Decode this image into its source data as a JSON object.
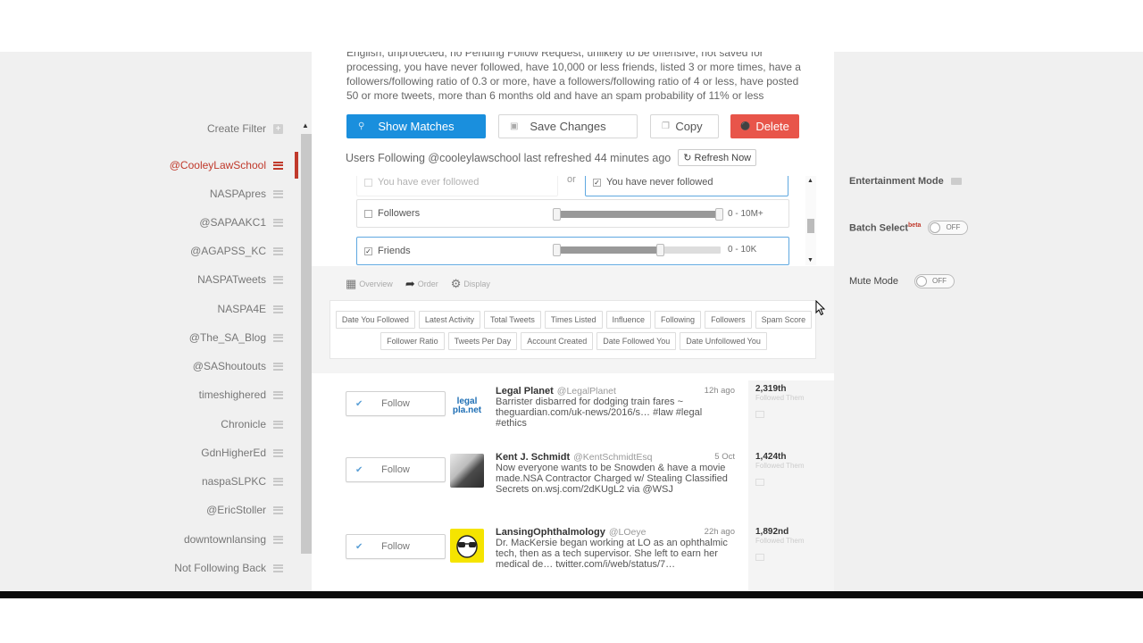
{
  "description": "English, unprotected, no Pending Follow Request, unlikely to be offensive, not saved for processing, you have never followed, have 10,000 or less friends, listed 3 or more times, have a followers/following ratio of 0.3 or more, have a followers/following ratio of 4 or less, have posted 50 or more tweets, more than 6 months old and have an spam probability of 11% or less",
  "sidebar": {
    "create_filter": "Create Filter",
    "items": [
      "@CooleyLawSchool",
      "NASPApres",
      "@SAPAAKC1",
      "@AGAPSS_KC",
      "NASPATweets",
      "NASPA4E",
      "@The_SA_Blog",
      "@SAShoutouts",
      "timeshighered",
      "Chronicle",
      "GdnHigherEd",
      "naspaSLPKC",
      "@EricStoller",
      "downtownlansing",
      "Not Following Back"
    ]
  },
  "actions": {
    "show_matches": "Show Matches",
    "save_changes": "Save Changes",
    "copy": "Copy",
    "delete": "Delete"
  },
  "refresh": {
    "text": "Users Following @cooleylawschool last refreshed 44 minutes ago",
    "button": "Refresh Now"
  },
  "filters": {
    "ever_followed": "You have ever followed",
    "or": "or",
    "never_followed": "You have never followed",
    "followers_label": "Followers",
    "followers_range": "0 - 10M+",
    "friends_label": "Friends",
    "friends_range": "0 - 10K",
    "friends_level": 0.5
  },
  "tabs": {
    "overview": "Overview",
    "order": "Order",
    "display": "Display"
  },
  "sort_row1": [
    "Date You Followed",
    "Latest Activity",
    "Total Tweets",
    "Times Listed",
    "Influence",
    "Following",
    "Followers",
    "Spam Score"
  ],
  "sort_row2": [
    "Follower Ratio",
    "Tweets Per Day",
    "Account Created",
    "Date Followed You",
    "Date Unfollowed You"
  ],
  "feed": [
    {
      "follow": "Follow",
      "name": "Legal Planet",
      "handle": "@LegalPlanet",
      "time": "12h ago",
      "text": "Barrister disbarred for dodging train fares ~ theguardian.com/uk-news/2016/s… #law #legal #ethics",
      "rank": "2,319th",
      "rank_label": "Followed Them",
      "avatar_text": "legal pla.net"
    },
    {
      "follow": "Follow",
      "name": "Kent J. Schmidt",
      "handle": "@KentSchmidtEsq",
      "time": "5 Oct",
      "text": "Now everyone wants to be Snowden & have a movie made.NSA Contractor Charged w/ Stealing Classified Secrets on.wsj.com/2dKUgL2 via @WSJ",
      "rank": "1,424th",
      "rank_label": "Followed Them"
    },
    {
      "follow": "Follow",
      "name": "LansingOphthalmology",
      "handle": "@LOeye",
      "time": "22h ago",
      "text": "Dr. MacKersie began working at LO as an ophthalmic tech, then as a tech supervisor. She left to earn her medical de… twitter.com/i/web/status/7…",
      "rank": "1,892nd",
      "rank_label": "Followed Them"
    }
  ],
  "right_panel": {
    "entertainment_mode": "Entertainment Mode",
    "batch_select": "Batch Select",
    "beta": "beta",
    "mute_mode": "Mute Mode",
    "off": "OFF"
  },
  "colors": {
    "accent_blue": "#1a8fdd",
    "danger_red": "#e8554a",
    "active_red": "#c0392b"
  }
}
